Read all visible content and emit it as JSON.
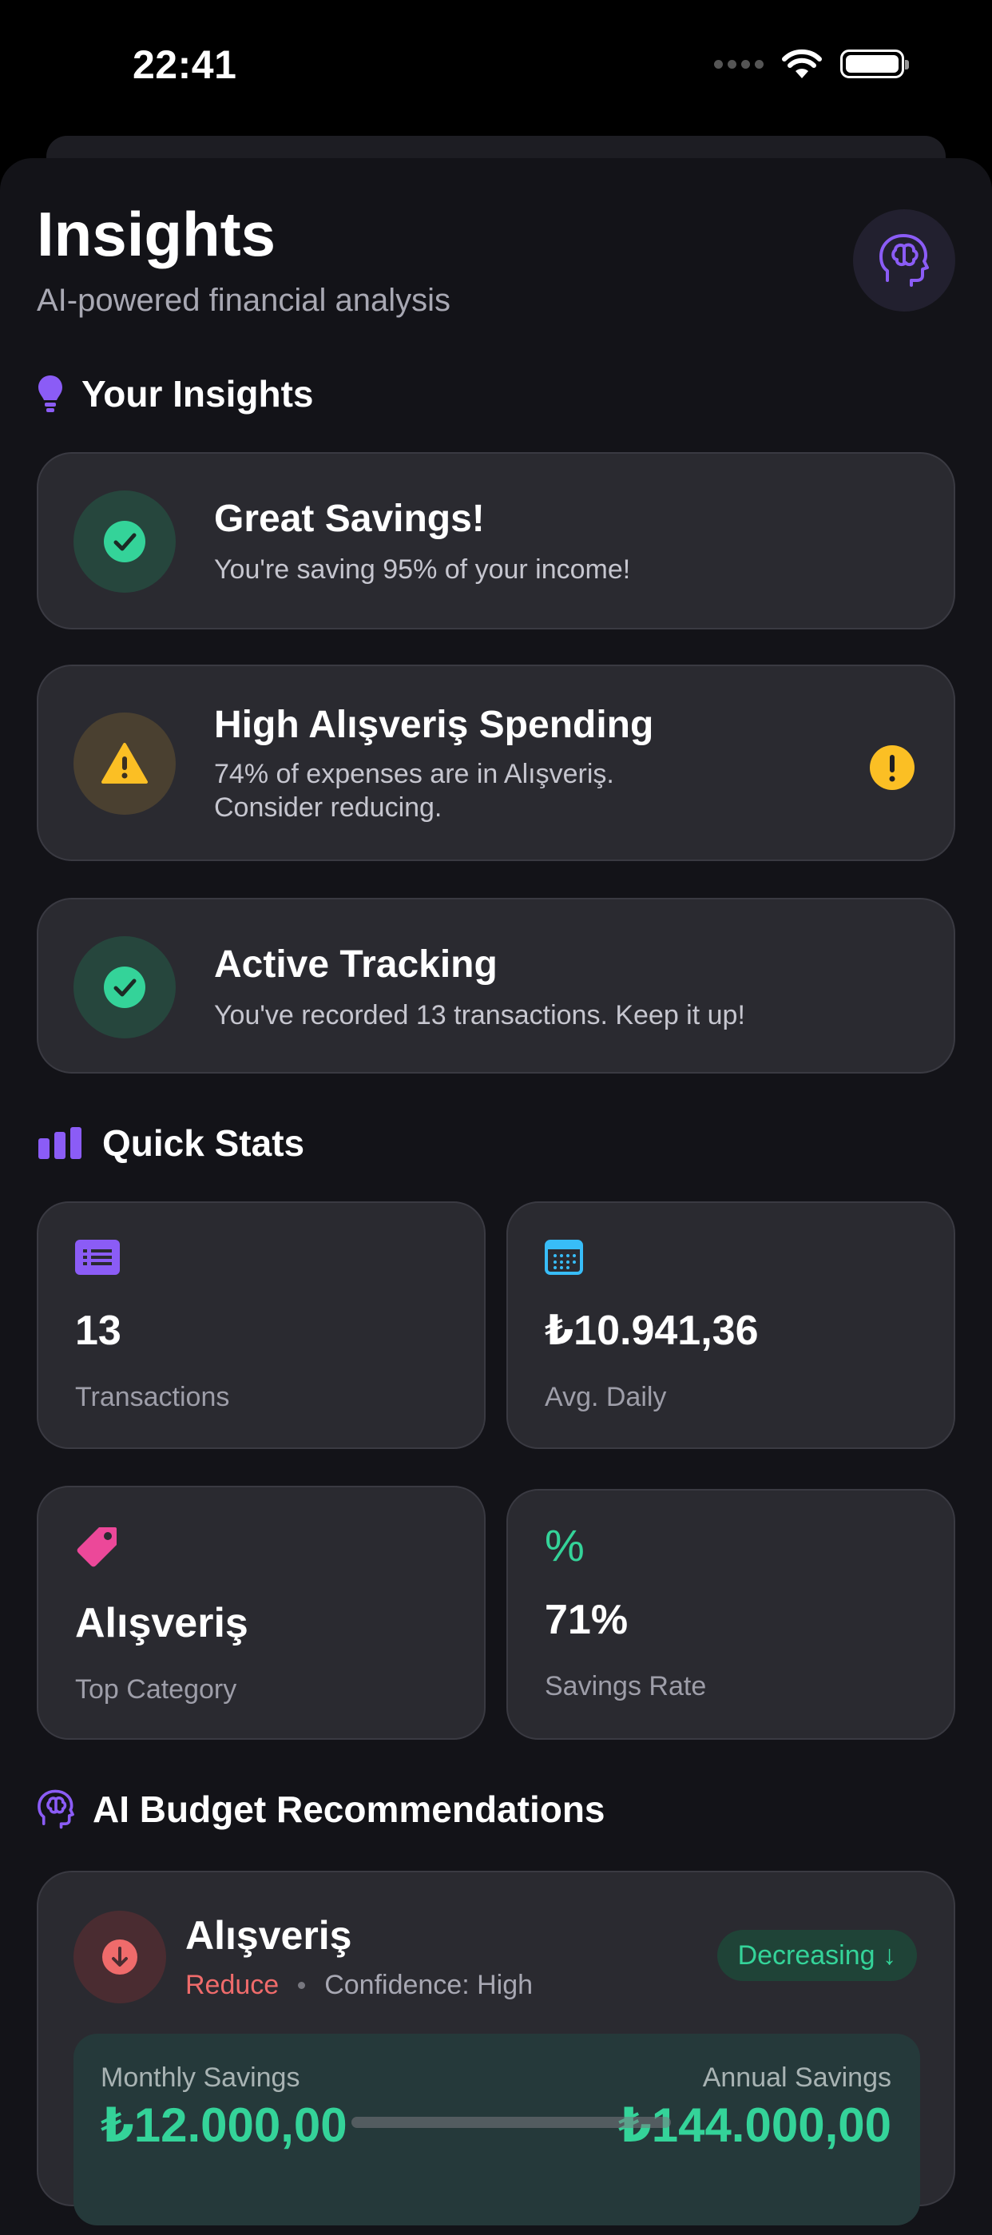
{
  "status_bar": {
    "time": "22:41"
  },
  "header": {
    "title": "Insights",
    "subtitle": "AI-powered financial analysis",
    "action_icon": "brain-icon"
  },
  "insights_section": {
    "title": "Your Insights",
    "icon": "lightbulb-icon",
    "cards": [
      {
        "title": "Great Savings!",
        "description": "You're saving 95% of your income!",
        "type": "success",
        "icon": "check-icon"
      },
      {
        "title": "High Alışveriş Spending",
        "description_line1": "74% of expenses are in Alışveriş.",
        "description_line2": "Consider reducing.",
        "type": "warning",
        "icon": "warning-triangle-icon",
        "badge_icon": "exclamation-icon"
      },
      {
        "title": "Active Tracking",
        "description": "You've recorded 13 transactions. Keep it up!",
        "type": "success",
        "icon": "check-icon"
      }
    ]
  },
  "quick_stats": {
    "title": "Quick Stats",
    "icon": "bar-chart-icon",
    "items": [
      {
        "value": "13",
        "label": "Transactions",
        "icon": "list-icon",
        "color": "#8b5cf6"
      },
      {
        "value": "₺10.941,36",
        "label": "Avg. Daily",
        "icon": "calendar-icon",
        "color": "#38bdf8"
      },
      {
        "value": "Alışveriş",
        "label": "Top Category",
        "icon": "tag-icon",
        "color": "#ec4899"
      },
      {
        "value": "71%",
        "label": "Savings Rate",
        "icon": "%",
        "color": "#34d399"
      }
    ]
  },
  "recommendations": {
    "title": "AI Budget Recommendations",
    "icon": "brain-icon",
    "items": [
      {
        "category": "Alışveriş",
        "action": "Reduce",
        "confidence": "Confidence: High",
        "trend": "Decreasing ↓",
        "monthly_label": "Monthly Savings",
        "monthly_value": "₺12.000,00",
        "annual_label": "Annual Savings",
        "annual_value": "₺144.000,00"
      }
    ]
  },
  "colors": {
    "accent_purple": "#8b5cf6",
    "success_green": "#34d399",
    "warning_yellow": "#fbbf24",
    "danger_red": "#ef6b6b",
    "background": "#131318",
    "card": "#2a2a30"
  }
}
